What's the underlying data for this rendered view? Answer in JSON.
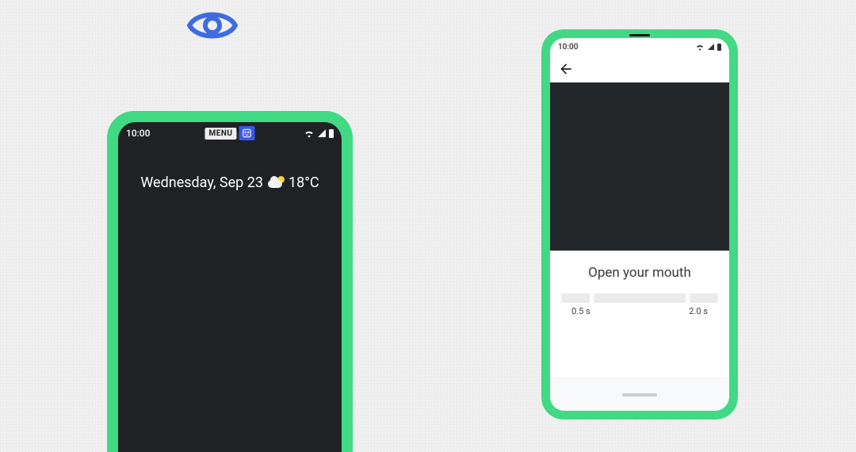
{
  "left_phone": {
    "time": "10:00",
    "menu_chip": "MENU",
    "face_chip_icon": "face-tracking-icon",
    "wifi_icon": "wifi-icon",
    "signal_icon": "cell-signal-icon",
    "battery_icon": "battery-icon",
    "date_text": "Wednesday, Sep 23",
    "weather_icon": "partly-cloudy-icon",
    "temperature": "18°C"
  },
  "right_phone": {
    "time": "10:00",
    "wifi_icon": "wifi-icon",
    "signal_icon": "cell-signal-icon",
    "battery_icon": "battery-icon",
    "back_icon": "arrow-back-icon",
    "prompt": "Open your mouth",
    "slider": {
      "left_label": "0.5 s",
      "right_label": "2.0 s"
    },
    "nav_icon": "gesture-pill-icon"
  },
  "overlay": {
    "eye_icon": "eye-icon"
  },
  "colors": {
    "phone_frame": "#41d984",
    "eye": "#3e6ce0",
    "menu_chip_accent": "#3858e8"
  }
}
